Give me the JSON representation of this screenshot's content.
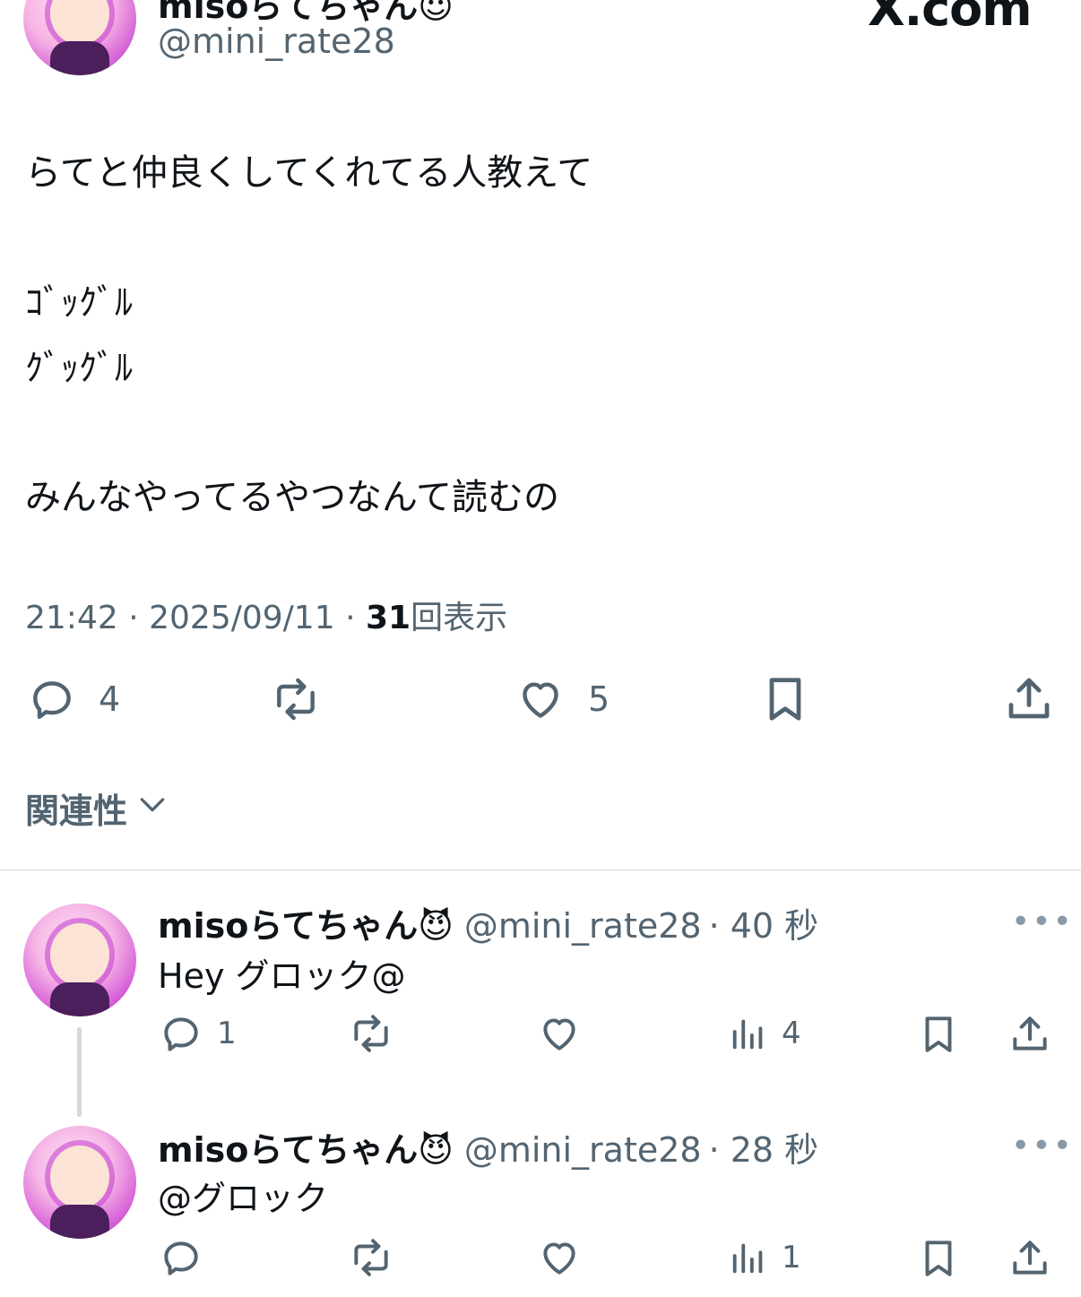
{
  "header": {
    "display_name": "misoらてちゃん😈",
    "handle": "@mini_rate28",
    "watermark": "X.com"
  },
  "tweet": {
    "lines": [
      "らてと仲良くしてくれてる人教えて",
      "ｺﾞｯｸﾞﾙ",
      "ｸﾞｯｸﾞﾙ",
      "みんなやってるやつなんて読むの"
    ],
    "time": "21:42",
    "date": "2025/09/11",
    "separator": "·",
    "views_count": "31",
    "views_label": "回表示",
    "reply_count": "4",
    "like_count": "5"
  },
  "related_label": "関連性",
  "replies": [
    {
      "display_name": "misoらてちゃん😈",
      "handle": "@mini_rate28",
      "age": "· 40 秒",
      "text": "Hey グロック@",
      "reply_count": "1",
      "views_count": "4"
    },
    {
      "display_name": "misoらてちゃん😈",
      "handle": "@mini_rate28",
      "age": "· 28 秒",
      "text": "@グロック",
      "reply_count": "",
      "views_count": "1"
    }
  ],
  "more_glyph": "•••",
  "icons": {
    "reply": "reply-icon",
    "repost": "repost-icon",
    "like": "heart-icon",
    "bookmark": "bookmark-icon",
    "share": "share-icon",
    "views": "views-icon",
    "chevron": "chevron-down-icon"
  },
  "colors": {
    "text": "#0f1419",
    "secondary": "#536471",
    "divider": "#cfd9de"
  }
}
